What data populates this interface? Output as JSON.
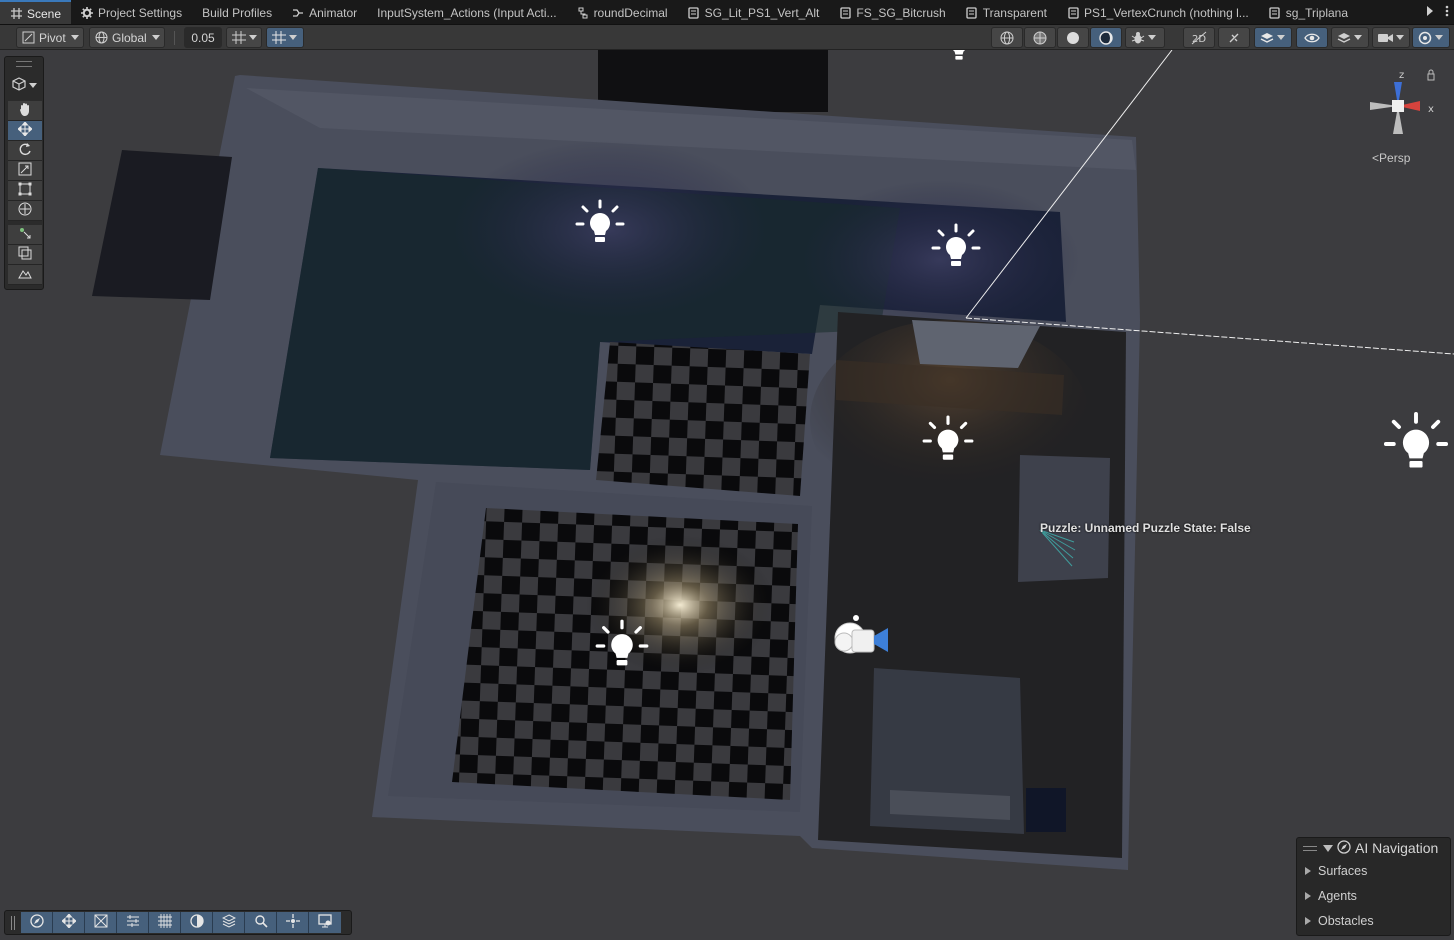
{
  "tabs": [
    {
      "label": "Scene",
      "icon": "grid-icon",
      "active": true
    },
    {
      "label": "Project Settings",
      "icon": "gear-icon"
    },
    {
      "label": "Build Profiles",
      "icon": ""
    },
    {
      "label": "Animator",
      "icon": "animator-icon"
    },
    {
      "label": "InputSystem_Actions (Input Acti...",
      "icon": ""
    },
    {
      "label": "roundDecimal",
      "icon": "shader-graph-icon"
    },
    {
      "label": "SG_Lit_PS1_Vert_Alt",
      "icon": "shader-graph-icon"
    },
    {
      "label": "FS_SG_Bitcrush",
      "icon": "shader-graph-icon"
    },
    {
      "label": "Transparent",
      "icon": "shader-graph-icon"
    },
    {
      "label": "PS1_VertexCrunch (nothing l...",
      "icon": "shader-graph-icon"
    },
    {
      "label": "sg_Triplana",
      "icon": "shader-graph-icon"
    }
  ],
  "toolbar": {
    "pivot_label": "Pivot",
    "global_label": "Global",
    "snap_value": "0.05"
  },
  "gizmo": {
    "persp_label": "Persp",
    "y_label": "z",
    "x_label": "x"
  },
  "scene": {
    "puzzle_label": "Puzzle: Unnamed Puzzle State: False"
  },
  "ai_navigation": {
    "title": "AI Navigation",
    "items": [
      "Surfaces",
      "Agents",
      "Obstacles"
    ]
  },
  "colors": {
    "accent": "#46607c",
    "active_tab_border": "#3a79bb",
    "viewport_bg": "#3d3d3f"
  }
}
